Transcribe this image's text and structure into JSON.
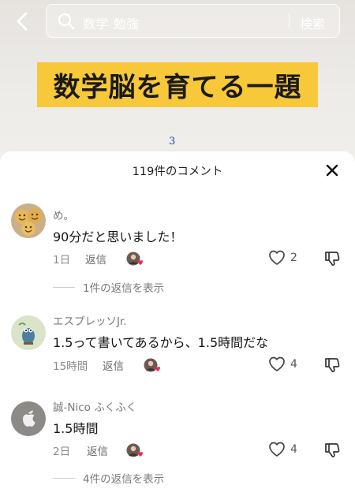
{
  "search": {
    "query": "数学 勉強",
    "button_label": "検索"
  },
  "video": {
    "title": "数学脳を育てる一題",
    "scribble": "3"
  },
  "comments_panel": {
    "title": "119件のコメント"
  },
  "comments": [
    {
      "username": "め。",
      "text": "90分だと思いました！",
      "time": "1日",
      "reply_label": "返信",
      "likes": "2",
      "view_replies": "1件の返信を表示"
    },
    {
      "username": "エスプレッソJr.",
      "text": "1.5って書いてあるから、1.5時間だな",
      "time": "15時間",
      "reply_label": "返信",
      "likes": "4",
      "view_replies": ""
    },
    {
      "username": "誠-Nico ふくふく",
      "text": "1.5時間",
      "time": "2日",
      "reply_label": "返信",
      "likes": "4",
      "view_replies": "4件の返信を表示"
    }
  ],
  "colors": {
    "title_bg": "#f6c83a",
    "heart_badge": "#ee2b5a"
  },
  "icons": [
    "back-icon",
    "search-icon",
    "close-icon",
    "heart-outline-icon",
    "dislike-icon",
    "creator-liked-badge"
  ]
}
